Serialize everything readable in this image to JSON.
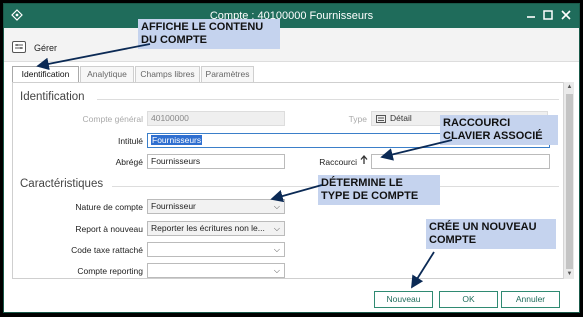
{
  "window": {
    "title": "Compte : 40100000 Fournisseurs",
    "app_icon": "diamond-icon",
    "controls": [
      "minimize-icon",
      "maximize-icon",
      "close-icon"
    ]
  },
  "toolbar": {
    "manage_label": "Gérer",
    "manage_icon": "manage-icon"
  },
  "tabs": [
    {
      "label": "Identification",
      "active": true
    },
    {
      "label": "Analytique",
      "active": false
    },
    {
      "label": "Champs libres",
      "active": false
    },
    {
      "label": "Paramètres",
      "active": false
    }
  ],
  "identification": {
    "section_title": "Identification",
    "compte_general": {
      "label": "Compte général",
      "value": "40100000"
    },
    "type": {
      "label": "Type",
      "value": "Détail",
      "icon": "detail-icon"
    },
    "intitule": {
      "label": "Intitulé",
      "value": "Fournisseurs"
    },
    "abrege": {
      "label": "Abrégé",
      "value": "Fournisseurs"
    },
    "raccourci": {
      "label": "Raccourci",
      "icon": "shortcut-icon",
      "value": ""
    }
  },
  "caracteristiques": {
    "section_title": "Caractéristiques",
    "nature_compte": {
      "label": "Nature de compte",
      "value": "Fournisseur"
    },
    "report_nouveau": {
      "label": "Report à nouveau",
      "value": "Reporter les écritures non le..."
    },
    "code_taxe": {
      "label": "Code taxe rattaché",
      "value": ""
    },
    "compte_reporting": {
      "label": "Compte reporting",
      "value": ""
    }
  },
  "buttons": {
    "nouveau": "Nouveau",
    "ok": "OK",
    "annuler": "Annuler"
  },
  "annotations": {
    "contenu": [
      "AFFICHE LE CONTENU",
      "DU COMPTE"
    ],
    "raccourci": [
      "RACCOURCI",
      "CLAVIER ASSOCIÉ"
    ],
    "type": [
      "DÉTERMINE LE",
      "TYPE DE COMPTE"
    ],
    "nouveau": [
      "CRÉE UN NOUVEAU",
      "COMPTE"
    ]
  },
  "colors": {
    "title_bar": "#1f6c5b",
    "button_border": "#2f8a72",
    "callout_bg": "#c5d3ee",
    "selection": "#2f6fd0"
  }
}
